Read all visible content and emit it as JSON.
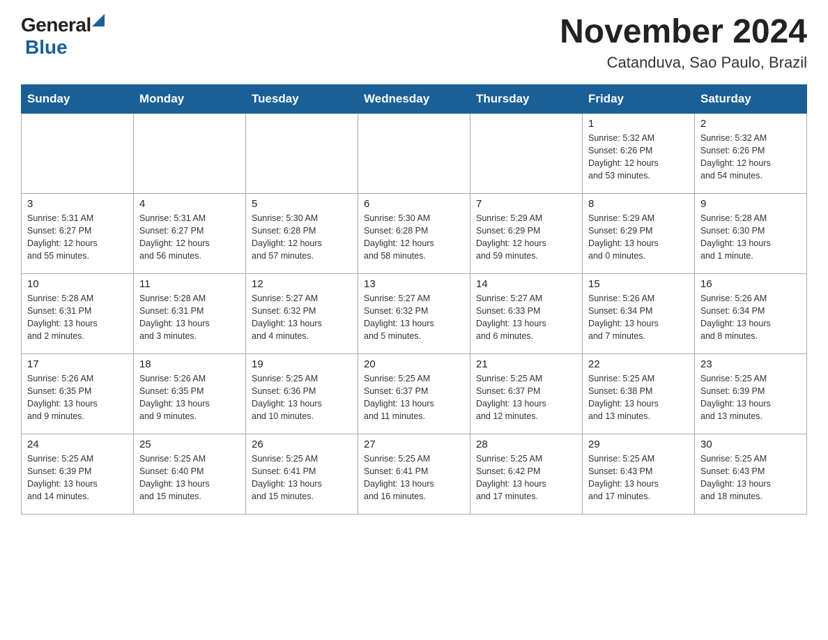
{
  "header": {
    "title": "November 2024",
    "subtitle": "Catanduva, Sao Paulo, Brazil",
    "logo_general": "General",
    "logo_blue": "Blue"
  },
  "weekdays": [
    "Sunday",
    "Monday",
    "Tuesday",
    "Wednesday",
    "Thursday",
    "Friday",
    "Saturday"
  ],
  "weeks": [
    [
      {
        "day": "",
        "info": ""
      },
      {
        "day": "",
        "info": ""
      },
      {
        "day": "",
        "info": ""
      },
      {
        "day": "",
        "info": ""
      },
      {
        "day": "",
        "info": ""
      },
      {
        "day": "1",
        "info": "Sunrise: 5:32 AM\nSunset: 6:26 PM\nDaylight: 12 hours\nand 53 minutes."
      },
      {
        "day": "2",
        "info": "Sunrise: 5:32 AM\nSunset: 6:26 PM\nDaylight: 12 hours\nand 54 minutes."
      }
    ],
    [
      {
        "day": "3",
        "info": "Sunrise: 5:31 AM\nSunset: 6:27 PM\nDaylight: 12 hours\nand 55 minutes."
      },
      {
        "day": "4",
        "info": "Sunrise: 5:31 AM\nSunset: 6:27 PM\nDaylight: 12 hours\nand 56 minutes."
      },
      {
        "day": "5",
        "info": "Sunrise: 5:30 AM\nSunset: 6:28 PM\nDaylight: 12 hours\nand 57 minutes."
      },
      {
        "day": "6",
        "info": "Sunrise: 5:30 AM\nSunset: 6:28 PM\nDaylight: 12 hours\nand 58 minutes."
      },
      {
        "day": "7",
        "info": "Sunrise: 5:29 AM\nSunset: 6:29 PM\nDaylight: 12 hours\nand 59 minutes."
      },
      {
        "day": "8",
        "info": "Sunrise: 5:29 AM\nSunset: 6:29 PM\nDaylight: 13 hours\nand 0 minutes."
      },
      {
        "day": "9",
        "info": "Sunrise: 5:28 AM\nSunset: 6:30 PM\nDaylight: 13 hours\nand 1 minute."
      }
    ],
    [
      {
        "day": "10",
        "info": "Sunrise: 5:28 AM\nSunset: 6:31 PM\nDaylight: 13 hours\nand 2 minutes."
      },
      {
        "day": "11",
        "info": "Sunrise: 5:28 AM\nSunset: 6:31 PM\nDaylight: 13 hours\nand 3 minutes."
      },
      {
        "day": "12",
        "info": "Sunrise: 5:27 AM\nSunset: 6:32 PM\nDaylight: 13 hours\nand 4 minutes."
      },
      {
        "day": "13",
        "info": "Sunrise: 5:27 AM\nSunset: 6:32 PM\nDaylight: 13 hours\nand 5 minutes."
      },
      {
        "day": "14",
        "info": "Sunrise: 5:27 AM\nSunset: 6:33 PM\nDaylight: 13 hours\nand 6 minutes."
      },
      {
        "day": "15",
        "info": "Sunrise: 5:26 AM\nSunset: 6:34 PM\nDaylight: 13 hours\nand 7 minutes."
      },
      {
        "day": "16",
        "info": "Sunrise: 5:26 AM\nSunset: 6:34 PM\nDaylight: 13 hours\nand 8 minutes."
      }
    ],
    [
      {
        "day": "17",
        "info": "Sunrise: 5:26 AM\nSunset: 6:35 PM\nDaylight: 13 hours\nand 9 minutes."
      },
      {
        "day": "18",
        "info": "Sunrise: 5:26 AM\nSunset: 6:35 PM\nDaylight: 13 hours\nand 9 minutes."
      },
      {
        "day": "19",
        "info": "Sunrise: 5:25 AM\nSunset: 6:36 PM\nDaylight: 13 hours\nand 10 minutes."
      },
      {
        "day": "20",
        "info": "Sunrise: 5:25 AM\nSunset: 6:37 PM\nDaylight: 13 hours\nand 11 minutes."
      },
      {
        "day": "21",
        "info": "Sunrise: 5:25 AM\nSunset: 6:37 PM\nDaylight: 13 hours\nand 12 minutes."
      },
      {
        "day": "22",
        "info": "Sunrise: 5:25 AM\nSunset: 6:38 PM\nDaylight: 13 hours\nand 13 minutes."
      },
      {
        "day": "23",
        "info": "Sunrise: 5:25 AM\nSunset: 6:39 PM\nDaylight: 13 hours\nand 13 minutes."
      }
    ],
    [
      {
        "day": "24",
        "info": "Sunrise: 5:25 AM\nSunset: 6:39 PM\nDaylight: 13 hours\nand 14 minutes."
      },
      {
        "day": "25",
        "info": "Sunrise: 5:25 AM\nSunset: 6:40 PM\nDaylight: 13 hours\nand 15 minutes."
      },
      {
        "day": "26",
        "info": "Sunrise: 5:25 AM\nSunset: 6:41 PM\nDaylight: 13 hours\nand 15 minutes."
      },
      {
        "day": "27",
        "info": "Sunrise: 5:25 AM\nSunset: 6:41 PM\nDaylight: 13 hours\nand 16 minutes."
      },
      {
        "day": "28",
        "info": "Sunrise: 5:25 AM\nSunset: 6:42 PM\nDaylight: 13 hours\nand 17 minutes."
      },
      {
        "day": "29",
        "info": "Sunrise: 5:25 AM\nSunset: 6:43 PM\nDaylight: 13 hours\nand 17 minutes."
      },
      {
        "day": "30",
        "info": "Sunrise: 5:25 AM\nSunset: 6:43 PM\nDaylight: 13 hours\nand 18 minutes."
      }
    ]
  ]
}
